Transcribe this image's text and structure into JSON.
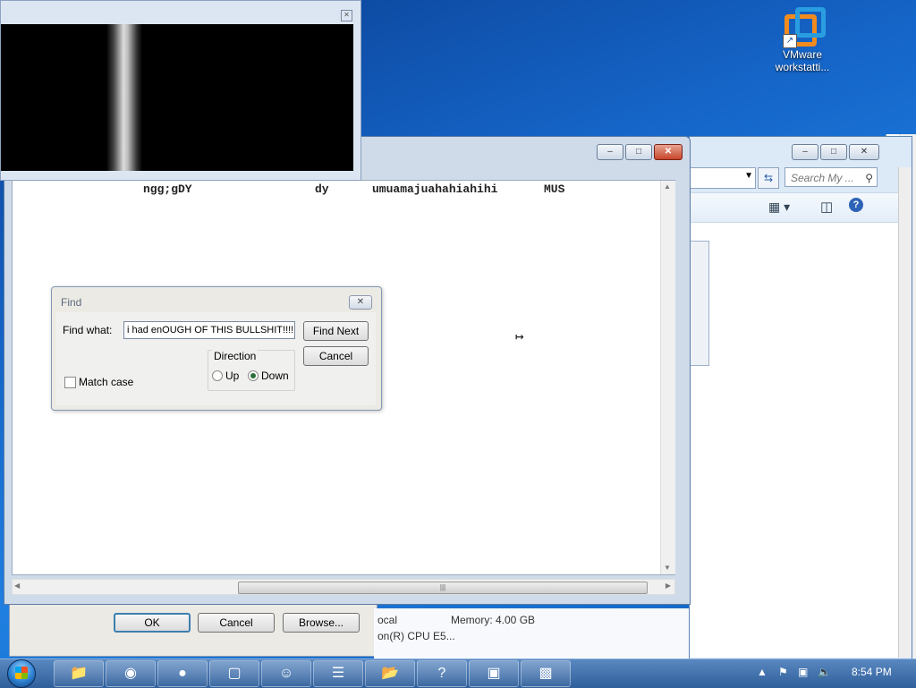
{
  "desktop": {
    "vmware_icon": {
      "label": "VMware workstatti..."
    }
  },
  "explorer": {
    "search_placeholder": "Search My ...",
    "buttons": {
      "minimize": "–",
      "maximize": "□",
      "close": "✕"
    }
  },
  "notepad": {
    "line_parts": [
      "ngg;gDY",
      "dy",
      "umuamajuahahiahihi",
      "MUS"
    ],
    "buttons": {
      "minimize": "–",
      "maximize": "□",
      "close": "✕"
    },
    "scroll_thumb_grip": "|||"
  },
  "props_dialog": {
    "ok": "OK",
    "cancel": "Cancel",
    "browse": "Browse..."
  },
  "computer_info": {
    "domain_fragment": "ocal",
    "memory": "Memory:  4.00 GB",
    "cpu_fragment": "on(R) CPU E5..."
  },
  "find_dialog": {
    "title": "Find",
    "find_what_label": "Find what:",
    "find_what_value": "i had  enOUGH OF THIS BULLSHIT!!!!",
    "find_next": "Find Next",
    "cancel": "Cancel",
    "direction_label": "Direction",
    "up_label": "Up",
    "down_label": "Down",
    "direction_selected": "Down",
    "match_case_label": "Match case",
    "match_case_checked": false
  },
  "taskbar": {
    "items": [
      "explorer-icon",
      "chrome-icon",
      "firefox-icon",
      "vmware-icon",
      "discord-icon",
      "notepad-icon",
      "folder-icon",
      "help-icon",
      "control-panel-icon",
      "remote-desktop-icon"
    ],
    "clock": "8:54 PM"
  }
}
